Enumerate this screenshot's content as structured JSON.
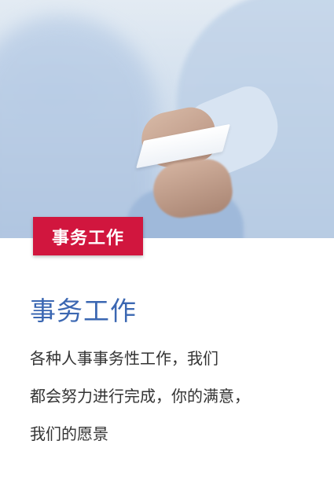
{
  "hero": {
    "image_alt": "business-card-handover-photo"
  },
  "tag": {
    "label": "事务工作"
  },
  "main": {
    "title": "事务工作",
    "description_lines": [
      "各种人事事务性工作，我们",
      "都会努力进行完成，你的满意，",
      "我们的愿景"
    ]
  },
  "colors": {
    "tag_bg": "#d1163e",
    "title": "#3b67b2",
    "body_text": "#333333"
  }
}
